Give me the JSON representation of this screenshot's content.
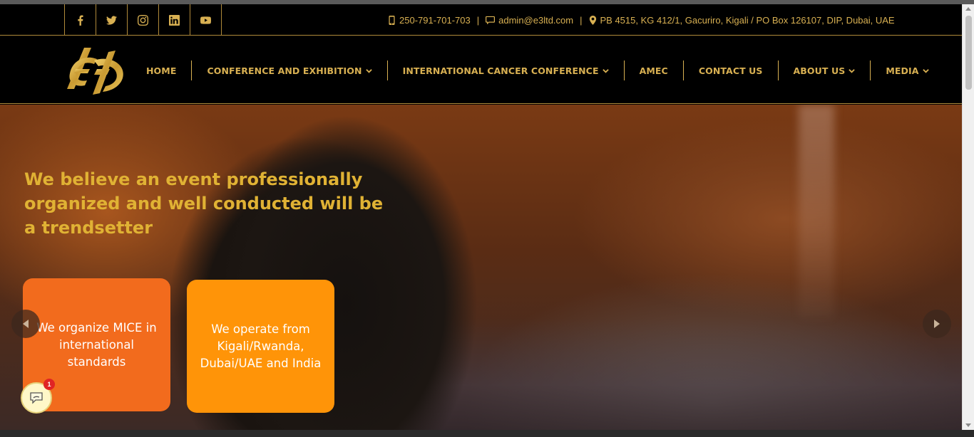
{
  "topbar": {
    "social": [
      {
        "name": "facebook-icon"
      },
      {
        "name": "twitter-icon"
      },
      {
        "name": "instagram-icon"
      },
      {
        "name": "linkedin-icon"
      },
      {
        "name": "youtube-icon"
      }
    ],
    "phone": "250-791-701-703",
    "email": "admin@e3ltd.com",
    "address": "PB 4515, KG 412/1, Gacuriro, Kigali / PO Box 126107, DIP, Dubai, UAE",
    "separator": "|"
  },
  "nav": {
    "items": [
      {
        "label": "HOME"
      },
      {
        "label": "CONFERENCE AND EXHIBITION"
      },
      {
        "label": "INTERNATIONAL CANCER CONFERENCE"
      },
      {
        "label": "AMEC"
      },
      {
        "label": "CONTACT US"
      },
      {
        "label": "ABOUT US"
      },
      {
        "label": "MEDIA"
      }
    ]
  },
  "hero": {
    "headline": "We believe an event professionally organized and well conducted will be a trendsetter",
    "cards": [
      {
        "text": "We organize MICE in international standards"
      },
      {
        "text": "We operate from Kigali/Rwanda, Dubai/UAE and India"
      }
    ]
  },
  "chat": {
    "badge": "1"
  },
  "colors": {
    "gold": "#d8b052",
    "headline": "#e0b234",
    "card_orange": "#f26b1d",
    "card_amber": "#ff9408"
  }
}
